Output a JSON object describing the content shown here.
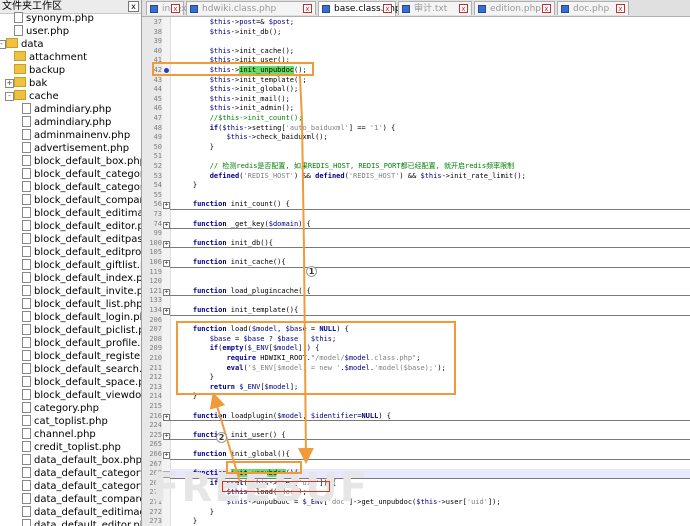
{
  "left_panel": {
    "title": "文件夹工作区",
    "close": "x",
    "items": [
      {
        "label": "synonym.php",
        "kind": "file",
        "indent": 1
      },
      {
        "label": "user.php",
        "kind": "file",
        "indent": 1
      },
      {
        "label": "data",
        "kind": "folder",
        "indent": 0,
        "toggle": "-"
      },
      {
        "label": "attachment",
        "kind": "folder",
        "indent": 1
      },
      {
        "label": "backup",
        "kind": "folder",
        "indent": 1
      },
      {
        "label": "bak",
        "kind": "folder",
        "indent": 1,
        "toggle": "+"
      },
      {
        "label": "cache",
        "kind": "folder",
        "indent": 1,
        "toggle": "-"
      },
      {
        "label": "admindiary.php",
        "kind": "file",
        "indent": 2
      },
      {
        "label": "admindiary.php",
        "kind": "file",
        "indent": 2
      },
      {
        "label": "adminmainenv.php",
        "kind": "file",
        "indent": 2
      },
      {
        "label": "advertisement.php",
        "kind": "file",
        "indent": 2
      },
      {
        "label": "block_default_box.php",
        "kind": "file",
        "indent": 2
      },
      {
        "label": "block_default_category.p",
        "kind": "file",
        "indent": 2
      },
      {
        "label": "block_default_categoryli",
        "kind": "file",
        "indent": 2
      },
      {
        "label": "block_default_compare.p",
        "kind": "file",
        "indent": 2
      },
      {
        "label": "block_default_editimage",
        "kind": "file",
        "indent": 2
      },
      {
        "label": "block_default_editor.php",
        "kind": "file",
        "indent": 2
      },
      {
        "label": "block_default_editpass.p",
        "kind": "file",
        "indent": 2
      },
      {
        "label": "block_default_editprofile",
        "kind": "file",
        "indent": 2
      },
      {
        "label": "block_default_giftlist.php",
        "kind": "file",
        "indent": 2
      },
      {
        "label": "block_default_index.php",
        "kind": "file",
        "indent": 2
      },
      {
        "label": "block_default_invite.php",
        "kind": "file",
        "indent": 2
      },
      {
        "label": "block_default_list.php",
        "kind": "file",
        "indent": 2
      },
      {
        "label": "block_default_login.php",
        "kind": "file",
        "indent": 2
      },
      {
        "label": "block_default_piclist.php",
        "kind": "file",
        "indent": 2
      },
      {
        "label": "block_default_profile.php",
        "kind": "file",
        "indent": 2
      },
      {
        "label": "block_default_register.ph",
        "kind": "file",
        "indent": 2
      },
      {
        "label": "block_default_search.php",
        "kind": "file",
        "indent": 2
      },
      {
        "label": "block_default_space.php",
        "kind": "file",
        "indent": 2
      },
      {
        "label": "block_default_viewdoc.p",
        "kind": "file",
        "indent": 2
      },
      {
        "label": "category.php",
        "kind": "file",
        "indent": 2
      },
      {
        "label": "cat_toplist.php",
        "kind": "file",
        "indent": 2
      },
      {
        "label": "channel.php",
        "kind": "file",
        "indent": 2
      },
      {
        "label": "credit_toplist.php",
        "kind": "file",
        "indent": 2
      },
      {
        "label": "data_default_box.php",
        "kind": "file",
        "indent": 2
      },
      {
        "label": "data_default_category.p",
        "kind": "file",
        "indent": 2
      },
      {
        "label": "data_default_categorylis",
        "kind": "file",
        "indent": 2
      },
      {
        "label": "data_default_compare.p",
        "kind": "file",
        "indent": 2
      },
      {
        "label": "data_default_editimage.",
        "kind": "file",
        "indent": 2
      },
      {
        "label": "data_default_editor.php",
        "kind": "file",
        "indent": 2
      }
    ]
  },
  "tabs": [
    {
      "label": "index.php",
      "active": false,
      "icon": "blue"
    },
    {
      "label": "hdwiki.class.php",
      "active": false,
      "icon": "blue"
    },
    {
      "label": "base.class.php",
      "active": true,
      "icon": "blue"
    },
    {
      "label": "审计.txt",
      "active": false,
      "icon": "blue"
    },
    {
      "label": "edition.php",
      "active": false,
      "icon": "blue"
    },
    {
      "label": "doc.php",
      "active": false,
      "icon": "blue"
    }
  ],
  "editor": {
    "lines": [
      {
        "n": "37",
        "html": "        <span class='var'>$this</span>-><span class='var'>post</span>=&amp; <span class='var'>$post</span>;"
      },
      {
        "n": "38",
        "html": "        <span class='var'>$this</span>->init_db();"
      },
      {
        "n": "39",
        "html": ""
      },
      {
        "n": "40",
        "html": "        <span class='var'>$this</span>->init_cache();"
      },
      {
        "n": "41",
        "html": "        <span class='var'>$this</span>->init_user();"
      },
      {
        "n": "42",
        "html": "        <span class='var'>$this</span>-><span class='hl-green'>init_unpubdoc</span>();",
        "bookmark": true
      },
      {
        "n": "43",
        "html": "        <span class='var'>$this</span>->init_template();"
      },
      {
        "n": "44",
        "html": "        <span class='var'>$this</span>->init_global();"
      },
      {
        "n": "45",
        "html": "        <span class='var'>$this</span>->init_mail();"
      },
      {
        "n": "46",
        "html": "        <span class='var'>$this</span>->init_admin();"
      },
      {
        "n": "47",
        "html": "        <span class='cmt'>//$this->init_count();</span>"
      },
      {
        "n": "48",
        "html": "        <span class='kw'>if</span>(<span class='var'>$this</span>->setting[<span class='str'>'auto_baiduxml'</span>] == <span class='str'>'1'</span>) {"
      },
      {
        "n": "49",
        "html": "            <span class='var'>$this</span>->check_baiduxml();"
      },
      {
        "n": "50",
        "html": "        }"
      },
      {
        "n": "51",
        "html": ""
      },
      {
        "n": "52",
        "html": "        <span class='cmtcn'>// 检测redis是否配置, 如果REDIS_HOST, REDIS_PORT都已经配置, 就开启redis频率限制</span>"
      },
      {
        "n": "53",
        "html": "        <span class='kw'>defined</span>(<span class='str'>'REDIS_HOST'</span>) &amp;&amp; <span class='kw'>defined</span>(<span class='str'>'REDIS_HOST'</span>) &amp;&amp; <span class='var'>$this</span>->init_rate_limit();"
      },
      {
        "n": "54",
        "html": "    }"
      },
      {
        "n": "55",
        "html": ""
      },
      {
        "n": "56",
        "html": "    <span class='kw'>function</span> init_count() {",
        "sep": true
      },
      {
        "n": "73",
        "html": ""
      },
      {
        "n": "74",
        "html": "    <span class='kw'>function</span> _get_key(<span class='var'>$domain</span>) {",
        "sep": true
      },
      {
        "n": "99",
        "html": ""
      },
      {
        "n": "100",
        "html": "    <span class='kw'>function</span> init_db(){",
        "sep": true
      },
      {
        "n": "105",
        "html": ""
      },
      {
        "n": "106",
        "html": "    <span class='kw'>function</span> init_cache(){",
        "sep": true
      },
      {
        "n": "119",
        "html": ""
      },
      {
        "n": "120",
        "html": ""
      },
      {
        "n": "121",
        "html": "    <span class='kw'>function</span> load_plugincache(){",
        "sep": true
      },
      {
        "n": "133",
        "html": ""
      },
      {
        "n": "134",
        "html": "    <span class='kw'>function</span> init_template(){",
        "sep": true
      },
      {
        "n": "206",
        "html": ""
      },
      {
        "n": "207",
        "html": "    <span class='kw'>function</span> load(<span class='var'>$model</span>, <span class='var'>$base</span> = <span class='kw'>NULL</span>) {"
      },
      {
        "n": "208",
        "html": "        <span class='var'>$base</span> = <span class='var'>$base</span> ? <span class='var'>$base</span> : <span class='var'>$this</span>;"
      },
      {
        "n": "209",
        "html": "        <span class='kw'>if</span>(<span class='kw'>empty</span>(<span class='var'>$_ENV</span>[<span class='var'>$model</span>])) {"
      },
      {
        "n": "210",
        "html": "            <span class='kw'>require</span> HDWIKI_ROOT.<span class='str'>\"/model/</span><span class='var'>$model</span><span class='str'>.class.php\"</span>;"
      },
      {
        "n": "211",
        "html": "            <span class='kw'>eval</span>(<span class='str'>'$_ENV[$model] = new '</span>.<span class='var'>$model</span>.<span class='str'>'model($base);'</span>);"
      },
      {
        "n": "212",
        "html": "        }"
      },
      {
        "n": "213",
        "html": "        <span class='kw'>return</span> <span class='var'>$_ENV</span>[<span class='var'>$model</span>];"
      },
      {
        "n": "214",
        "html": "    }"
      },
      {
        "n": "215",
        "html": ""
      },
      {
        "n": "216",
        "html": "    <span class='kw'>function</span> loadplugin(<span class='var'>$model</span>, <span class='var'>$identifier</span>=<span class='kw'>NULL</span>) {",
        "sep": true
      },
      {
        "n": "224",
        "html": ""
      },
      {
        "n": "225",
        "html": "    <span class='kw'>function</span> init_user() {",
        "sep": true
      },
      {
        "n": "265",
        "html": ""
      },
      {
        "n": "266",
        "html": "    <span class='kw'>function</span> init_global(){",
        "sep": true
      },
      {
        "n": "267",
        "html": ""
      },
      {
        "n": "268",
        "html": "    <span class='kw'>function</span> <span class='hl-green'>init_unpubdoc</span>(){",
        "sep": true,
        "current": true
      },
      {
        "n": "269",
        "html": "        <span class='kw'>if</span>(<span class='kw'>isset</span>(<span class='var'>$this</span>->user[<span class='str'>'uid'</span>])){"
      },
      {
        "n": "270",
        "html": "            <span class='var'>$this</span>->load(<span class='str'>'doc'</span>);"
      },
      {
        "n": "271",
        "html": "            <span class='var'>$this</span>->unpubdoc = <span class='var'>$_ENV</span>[<span class='str'>'doc'</span>]->get_unpubdoc(<span class='var'>$this</span>->user[<span class='str'>'uid'</span>]);"
      },
      {
        "n": "272",
        "html": "        }"
      },
      {
        "n": "273",
        "html": "    }"
      }
    ]
  },
  "annotations": {
    "step1": "1",
    "step2": "2",
    "watermark": "FREEBUF"
  }
}
